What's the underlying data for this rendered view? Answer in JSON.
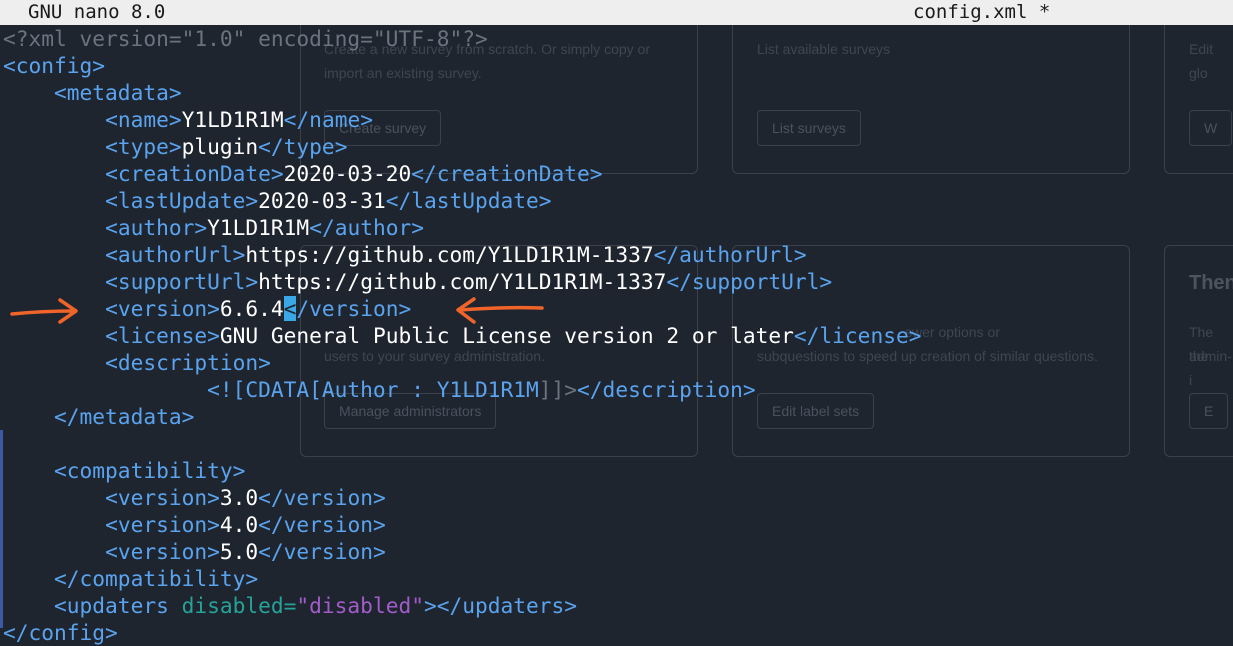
{
  "titlebar": {
    "app_name": "GNU nano 8.0",
    "file_name": "config.xml *"
  },
  "background_ui": {
    "texts": [
      "Create a new survey from scratch. Or simply copy or",
      "import an existing survey.",
      "List available surveys",
      "Edit glo",
      "users to your survey administration.",
      "swer options or",
      "subquestions to speed up creation of similar questions.",
      "The the",
      "admin-i",
      "Then"
    ],
    "buttons": [
      "Create survey",
      "List surveys",
      "W",
      "Manage administrators",
      "Edit label sets",
      "E"
    ]
  },
  "code_lines": [
    [
      {
        "c": "pi",
        "t": "<?xml version=\"1.0\" encoding=\"UTF-8\"?>"
      }
    ],
    [
      {
        "c": "t",
        "t": "<config>"
      }
    ],
    [
      {
        "c": "",
        "t": "    "
      },
      {
        "c": "t",
        "t": "<metadata>"
      }
    ],
    [
      {
        "c": "",
        "t": "        "
      },
      {
        "c": "t",
        "t": "<name>"
      },
      {
        "c": "",
        "t": "Y1LD1R1M"
      },
      {
        "c": "t",
        "t": "</name>"
      }
    ],
    [
      {
        "c": "",
        "t": "        "
      },
      {
        "c": "t",
        "t": "<type>"
      },
      {
        "c": "",
        "t": "plugin"
      },
      {
        "c": "t",
        "t": "</type>"
      }
    ],
    [
      {
        "c": "",
        "t": "        "
      },
      {
        "c": "t",
        "t": "<creationDate>"
      },
      {
        "c": "",
        "t": "2020-03-20"
      },
      {
        "c": "t",
        "t": "</creationDate>"
      }
    ],
    [
      {
        "c": "",
        "t": "        "
      },
      {
        "c": "t",
        "t": "<lastUpdate>"
      },
      {
        "c": "",
        "t": "2020-03-31"
      },
      {
        "c": "t",
        "t": "</lastUpdate>"
      }
    ],
    [
      {
        "c": "",
        "t": "        "
      },
      {
        "c": "t",
        "t": "<author>"
      },
      {
        "c": "",
        "t": "Y1LD1R1M"
      },
      {
        "c": "t",
        "t": "</author>"
      }
    ],
    [
      {
        "c": "",
        "t": "        "
      },
      {
        "c": "t",
        "t": "<authorUrl>"
      },
      {
        "c": "",
        "t": "https://github.com/Y1LD1R1M-1337"
      },
      {
        "c": "t",
        "t": "</authorUrl>"
      }
    ],
    [
      {
        "c": "",
        "t": "        "
      },
      {
        "c": "t",
        "t": "<supportUrl>"
      },
      {
        "c": "",
        "t": "https://github.com/Y1LD1R1M-1337"
      },
      {
        "c": "t",
        "t": "</supportUrl>"
      }
    ],
    [
      {
        "c": "",
        "t": "        "
      },
      {
        "c": "t",
        "t": "<version>"
      },
      {
        "c": "",
        "t": "6.6.4"
      },
      {
        "c": "t cur",
        "t": "<"
      },
      {
        "c": "t",
        "t": "/version>"
      }
    ],
    [
      {
        "c": "",
        "t": "        "
      },
      {
        "c": "t",
        "t": "<license>"
      },
      {
        "c": "",
        "t": "GNU General Public License version 2 or later"
      },
      {
        "c": "t",
        "t": "</license>"
      }
    ],
    [
      {
        "c": "",
        "t": "        "
      },
      {
        "c": "t",
        "t": "<description>"
      }
    ],
    [
      {
        "c": "",
        "t": "                "
      },
      {
        "c": "t",
        "t": "<![CDATA[Author : Y1LD1R1M"
      },
      {
        "c": "cd",
        "t": "]]>"
      },
      {
        "c": "t",
        "t": "</description>"
      }
    ],
    [
      {
        "c": "",
        "t": "    "
      },
      {
        "c": "t",
        "t": "</metadata>"
      }
    ],
    [],
    [
      {
        "c": "",
        "t": "    "
      },
      {
        "c": "t",
        "t": "<compatibility>"
      }
    ],
    [
      {
        "c": "",
        "t": "        "
      },
      {
        "c": "t",
        "t": "<version>"
      },
      {
        "c": "",
        "t": "3.0"
      },
      {
        "c": "t",
        "t": "</version>"
      }
    ],
    [
      {
        "c": "",
        "t": "        "
      },
      {
        "c": "t",
        "t": "<version>"
      },
      {
        "c": "",
        "t": "4.0"
      },
      {
        "c": "t",
        "t": "</version>"
      }
    ],
    [
      {
        "c": "",
        "t": "        "
      },
      {
        "c": "t",
        "t": "<version>"
      },
      {
        "c": "",
        "t": "5.0"
      },
      {
        "c": "t",
        "t": "</version>"
      }
    ],
    [
      {
        "c": "",
        "t": "    "
      },
      {
        "c": "t",
        "t": "</compatibility>"
      }
    ],
    [
      {
        "c": "",
        "t": "    "
      },
      {
        "c": "t",
        "t": "<updaters "
      },
      {
        "c": "at",
        "t": "disabled="
      },
      {
        "c": "av",
        "t": "\"disabled\""
      },
      {
        "c": "t",
        "t": "></updaters>"
      }
    ],
    [
      {
        "c": "t",
        "t": "</config>"
      }
    ]
  ],
  "colors": {
    "tag": "#5aa3ee",
    "declaration": "#6b7380",
    "attribute": "#26a398",
    "attribute_value": "#a35bcc",
    "cursor": "#3aa8e6",
    "annotation_arrow": "#f0642a"
  },
  "annotations": {
    "arrows": [
      "arrow-right-icon",
      "arrow-left-icon"
    ]
  }
}
